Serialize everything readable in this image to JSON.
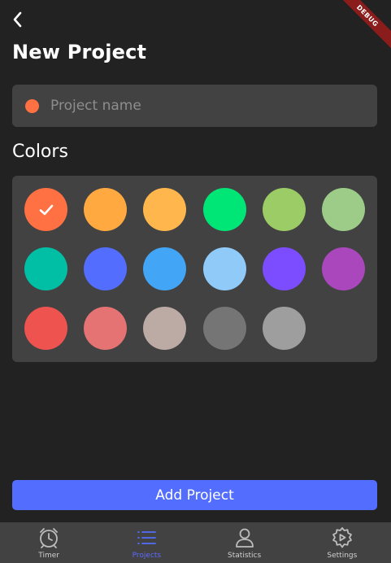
{
  "header": {
    "title": "New Project",
    "debug_label": "DEBUG",
    "back_icon": "chevron-left-icon"
  },
  "name_field": {
    "placeholder": "Project name",
    "value": "",
    "dot_color": "#ff7043"
  },
  "colors_section": {
    "title": "Colors",
    "selected_index": 0,
    "swatches": [
      "#ff7043",
      "#ffa940",
      "#ffb74d",
      "#00e676",
      "#9ccc65",
      "#9ccc88",
      "#00bfa5",
      "#536dfe",
      "#42a5f5",
      "#90caf9",
      "#7c4dff",
      "#ab47bc",
      "#ef5350",
      "#e57373",
      "#bcaaa4",
      "#757575",
      "#9e9e9e"
    ]
  },
  "actions": {
    "add_label": "Add Project"
  },
  "theme": {
    "accent": "#536dfe",
    "background": "#222222",
    "surface": "#424242"
  },
  "bottom_nav": {
    "items": [
      {
        "label": "Timer",
        "icon": "alarm-clock-icon",
        "active": false
      },
      {
        "label": "Projects",
        "icon": "list-icon",
        "active": true
      },
      {
        "label": "Statistics",
        "icon": "person-icon",
        "active": false
      },
      {
        "label": "Settings",
        "icon": "gear-icon",
        "active": false
      }
    ]
  }
}
